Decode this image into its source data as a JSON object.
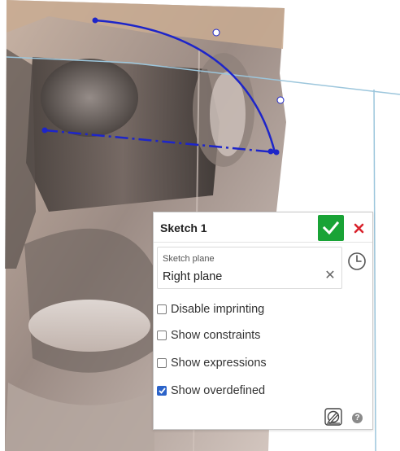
{
  "panel": {
    "title": "Sketch 1",
    "sketch_plane": {
      "caption": "Sketch plane",
      "value": "Right plane",
      "clear_icon": "close-icon"
    },
    "accept_icon": "check-icon",
    "cancel_icon": "close-icon",
    "history_icon": "clock-icon",
    "options": [
      {
        "label": "Disable imprinting",
        "checked": false
      },
      {
        "label": "Show constraints",
        "checked": false
      },
      {
        "label": "Show expressions",
        "checked": false
      },
      {
        "label": "Show overdefined",
        "checked": true
      }
    ],
    "help_label": "?",
    "sketch_tool_icon": "sketch-pen-icon"
  },
  "colors": {
    "accept_green": "#19a336",
    "cancel_red": "#d9232d",
    "sketch_blue": "#1d25c9",
    "plane_edge": "#9cc6dc",
    "checkbox_blue": "#2b63c9"
  }
}
